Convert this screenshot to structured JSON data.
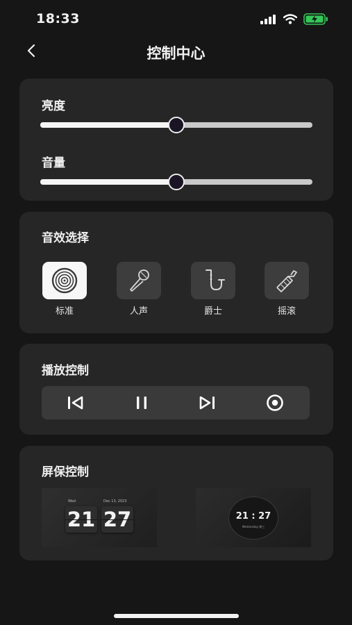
{
  "status": {
    "time": "18:33",
    "battery_color": "#34c759"
  },
  "nav": {
    "title": "控制中心",
    "back_icon": "chevron-left-icon"
  },
  "brightness": {
    "label": "亮度",
    "value_percent": 50
  },
  "volume": {
    "label": "音量",
    "value_percent": 50
  },
  "sound_effects": {
    "title": "音效选择",
    "items": [
      {
        "label": "标准",
        "icon": "vinyl-record-icon",
        "selected": true
      },
      {
        "label": "人声",
        "icon": "microphone-icon",
        "selected": false
      },
      {
        "label": "爵士",
        "icon": "saxophone-icon",
        "selected": false
      },
      {
        "label": "摇滚",
        "icon": "guitar-icon",
        "selected": false
      }
    ]
  },
  "playback": {
    "title": "播放控制",
    "buttons": [
      "previous-icon",
      "pause-icon",
      "next-icon",
      "record-icon"
    ]
  },
  "screensaver": {
    "title": "屏保控制",
    "flip_clock": {
      "day": "Wed",
      "date": "Dec 13, 2023",
      "hour": "21",
      "minute": "27"
    },
    "round_clock": {
      "time": "21 : 27",
      "subtitle": "Wednesday 周三"
    }
  }
}
